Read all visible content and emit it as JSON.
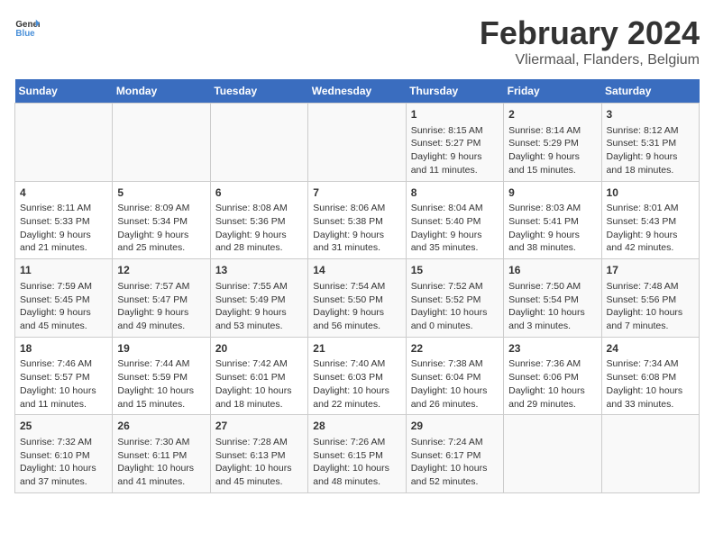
{
  "header": {
    "logo_general": "General",
    "logo_blue": "Blue",
    "main_title": "February 2024",
    "subtitle": "Vliermaal, Flanders, Belgium"
  },
  "days_of_week": [
    "Sunday",
    "Monday",
    "Tuesday",
    "Wednesday",
    "Thursday",
    "Friday",
    "Saturday"
  ],
  "weeks": [
    [
      {
        "day": "",
        "info": ""
      },
      {
        "day": "",
        "info": ""
      },
      {
        "day": "",
        "info": ""
      },
      {
        "day": "",
        "info": ""
      },
      {
        "day": "1",
        "info": "Sunrise: 8:15 AM\nSunset: 5:27 PM\nDaylight: 9 hours\nand 11 minutes."
      },
      {
        "day": "2",
        "info": "Sunrise: 8:14 AM\nSunset: 5:29 PM\nDaylight: 9 hours\nand 15 minutes."
      },
      {
        "day": "3",
        "info": "Sunrise: 8:12 AM\nSunset: 5:31 PM\nDaylight: 9 hours\nand 18 minutes."
      }
    ],
    [
      {
        "day": "4",
        "info": "Sunrise: 8:11 AM\nSunset: 5:33 PM\nDaylight: 9 hours\nand 21 minutes."
      },
      {
        "day": "5",
        "info": "Sunrise: 8:09 AM\nSunset: 5:34 PM\nDaylight: 9 hours\nand 25 minutes."
      },
      {
        "day": "6",
        "info": "Sunrise: 8:08 AM\nSunset: 5:36 PM\nDaylight: 9 hours\nand 28 minutes."
      },
      {
        "day": "7",
        "info": "Sunrise: 8:06 AM\nSunset: 5:38 PM\nDaylight: 9 hours\nand 31 minutes."
      },
      {
        "day": "8",
        "info": "Sunrise: 8:04 AM\nSunset: 5:40 PM\nDaylight: 9 hours\nand 35 minutes."
      },
      {
        "day": "9",
        "info": "Sunrise: 8:03 AM\nSunset: 5:41 PM\nDaylight: 9 hours\nand 38 minutes."
      },
      {
        "day": "10",
        "info": "Sunrise: 8:01 AM\nSunset: 5:43 PM\nDaylight: 9 hours\nand 42 minutes."
      }
    ],
    [
      {
        "day": "11",
        "info": "Sunrise: 7:59 AM\nSunset: 5:45 PM\nDaylight: 9 hours\nand 45 minutes."
      },
      {
        "day": "12",
        "info": "Sunrise: 7:57 AM\nSunset: 5:47 PM\nDaylight: 9 hours\nand 49 minutes."
      },
      {
        "day": "13",
        "info": "Sunrise: 7:55 AM\nSunset: 5:49 PM\nDaylight: 9 hours\nand 53 minutes."
      },
      {
        "day": "14",
        "info": "Sunrise: 7:54 AM\nSunset: 5:50 PM\nDaylight: 9 hours\nand 56 minutes."
      },
      {
        "day": "15",
        "info": "Sunrise: 7:52 AM\nSunset: 5:52 PM\nDaylight: 10 hours\nand 0 minutes."
      },
      {
        "day": "16",
        "info": "Sunrise: 7:50 AM\nSunset: 5:54 PM\nDaylight: 10 hours\nand 3 minutes."
      },
      {
        "day": "17",
        "info": "Sunrise: 7:48 AM\nSunset: 5:56 PM\nDaylight: 10 hours\nand 7 minutes."
      }
    ],
    [
      {
        "day": "18",
        "info": "Sunrise: 7:46 AM\nSunset: 5:57 PM\nDaylight: 10 hours\nand 11 minutes."
      },
      {
        "day": "19",
        "info": "Sunrise: 7:44 AM\nSunset: 5:59 PM\nDaylight: 10 hours\nand 15 minutes."
      },
      {
        "day": "20",
        "info": "Sunrise: 7:42 AM\nSunset: 6:01 PM\nDaylight: 10 hours\nand 18 minutes."
      },
      {
        "day": "21",
        "info": "Sunrise: 7:40 AM\nSunset: 6:03 PM\nDaylight: 10 hours\nand 22 minutes."
      },
      {
        "day": "22",
        "info": "Sunrise: 7:38 AM\nSunset: 6:04 PM\nDaylight: 10 hours\nand 26 minutes."
      },
      {
        "day": "23",
        "info": "Sunrise: 7:36 AM\nSunset: 6:06 PM\nDaylight: 10 hours\nand 29 minutes."
      },
      {
        "day": "24",
        "info": "Sunrise: 7:34 AM\nSunset: 6:08 PM\nDaylight: 10 hours\nand 33 minutes."
      }
    ],
    [
      {
        "day": "25",
        "info": "Sunrise: 7:32 AM\nSunset: 6:10 PM\nDaylight: 10 hours\nand 37 minutes."
      },
      {
        "day": "26",
        "info": "Sunrise: 7:30 AM\nSunset: 6:11 PM\nDaylight: 10 hours\nand 41 minutes."
      },
      {
        "day": "27",
        "info": "Sunrise: 7:28 AM\nSunset: 6:13 PM\nDaylight: 10 hours\nand 45 minutes."
      },
      {
        "day": "28",
        "info": "Sunrise: 7:26 AM\nSunset: 6:15 PM\nDaylight: 10 hours\nand 48 minutes."
      },
      {
        "day": "29",
        "info": "Sunrise: 7:24 AM\nSunset: 6:17 PM\nDaylight: 10 hours\nand 52 minutes."
      },
      {
        "day": "",
        "info": ""
      },
      {
        "day": "",
        "info": ""
      }
    ]
  ]
}
